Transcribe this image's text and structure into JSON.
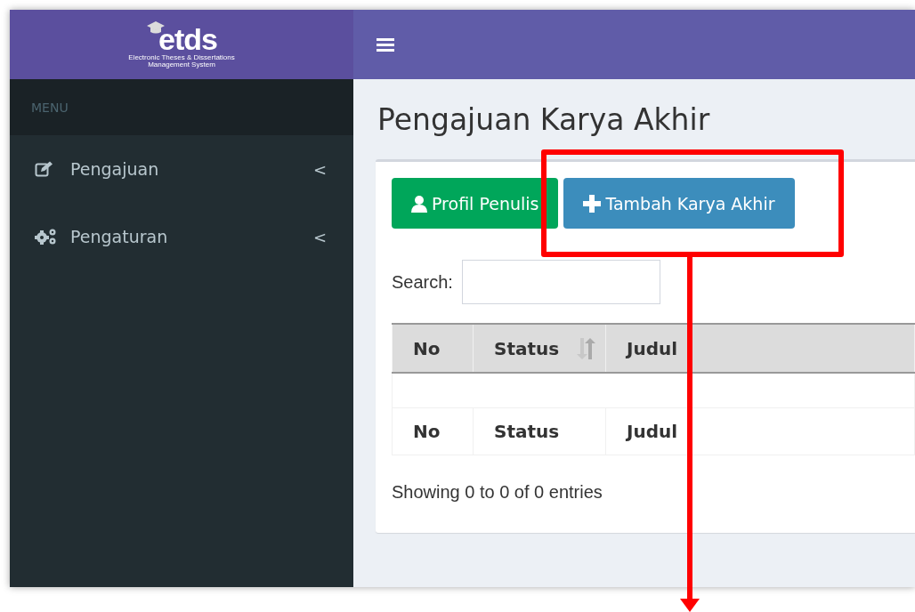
{
  "header": {
    "logo": {
      "name": "etds",
      "subtitle_line_1": "Electronic Theses & Dissertations",
      "subtitle_line_2": "Management System"
    }
  },
  "sidebar": {
    "heading": "MENU",
    "items": [
      {
        "label": "Pengajuan",
        "chevron": "<",
        "expanded": false
      },
      {
        "label": "Pengaturan",
        "chevron": "<",
        "expanded": false
      }
    ]
  },
  "content": {
    "title": "Pengajuan Karya Akhir",
    "buttons": [
      {
        "label": "Profil Penulis",
        "kind": "success"
      },
      {
        "label": "Tambah Karya Akhir",
        "kind": "primary"
      }
    ],
    "search": {
      "label": "Search:"
    },
    "table": {
      "columns": [
        {
          "label": "No",
          "sortable": false
        },
        {
          "label": "Status",
          "sortable": true
        },
        {
          "label": "Judul",
          "sortable": false
        }
      ],
      "footer": [
        "No",
        "Status",
        "Judul"
      ]
    },
    "info": "Showing 0 to 0 of 0 entries"
  }
}
